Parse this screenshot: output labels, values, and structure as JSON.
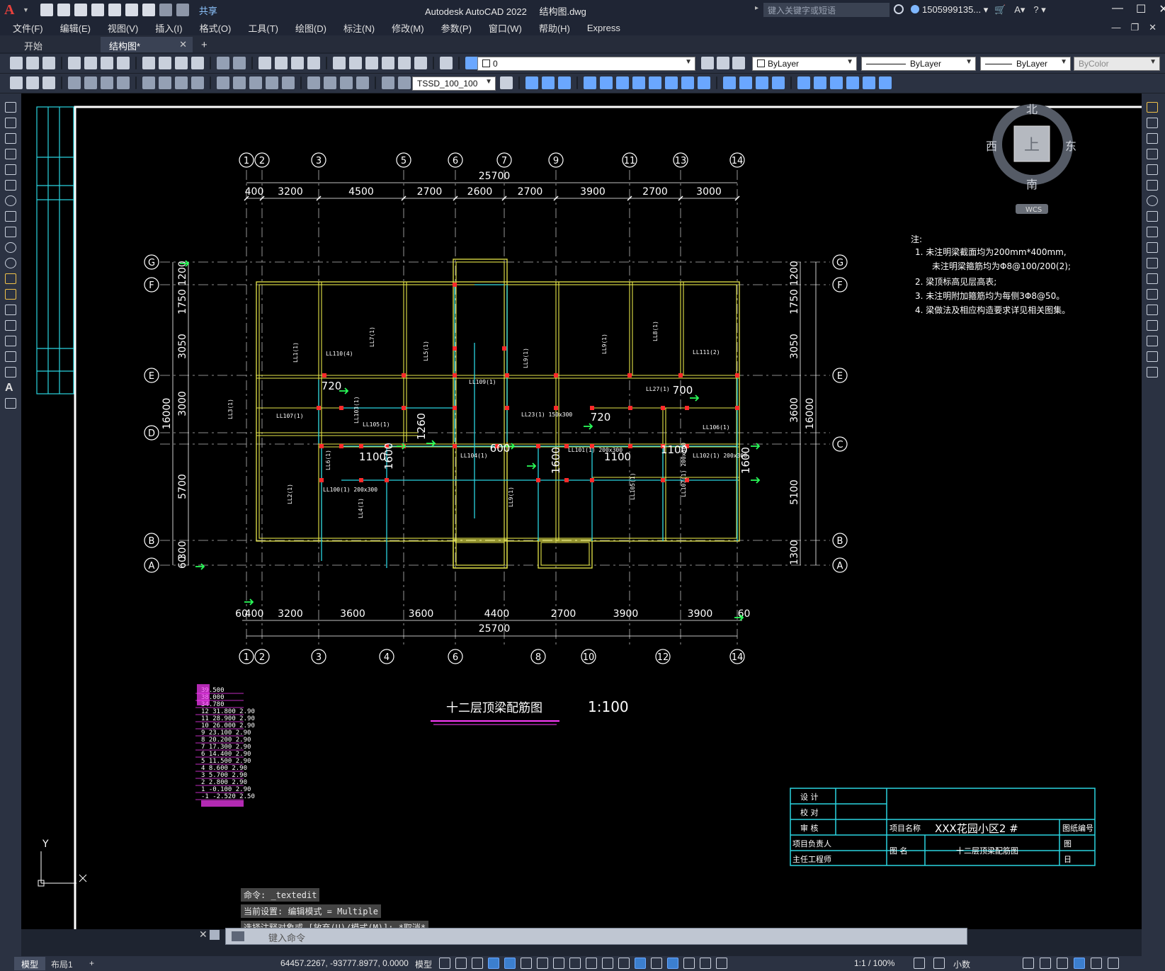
{
  "window": {
    "app_title": "Autodesk AutoCAD 2022",
    "file_title": "结构图.dwg",
    "search_placeholder": "键入关键字或短语",
    "user": "1505999135...",
    "share": "共享"
  },
  "menu": [
    "文件(F)",
    "编辑(E)",
    "视图(V)",
    "插入(I)",
    "格式(O)",
    "工具(T)",
    "绘图(D)",
    "标注(N)",
    "修改(M)",
    "参数(P)",
    "窗口(W)",
    "帮助(H)",
    "Express"
  ],
  "tabs": {
    "start": "开始",
    "active": "结构图*",
    "plus": "+"
  },
  "properties": {
    "layer": "0",
    "color": "ByLayer",
    "linetype": "ByLayer",
    "lineweight": "ByLayer",
    "plotstyle": "ByColor",
    "text_style": "TSSD_100_100"
  },
  "viewcube": {
    "top": "上",
    "north": "北",
    "south": "南",
    "east": "东",
    "west": "西",
    "wcs": "WCS"
  },
  "command": {
    "history": [
      "命令: _textedit",
      "当前设置: 编辑模式 = Multiple",
      "选择注释对象或 [放弃(U)/模式(M)]: *取消*"
    ],
    "placeholder": "键入命令"
  },
  "status": {
    "layout_tabs": [
      "模型",
      "布局1"
    ],
    "coords": "64457.2267, -93777.8977, 0.0000",
    "space": "模型",
    "scale": "1:1 / 100%",
    "units": "小数"
  },
  "drawing": {
    "title": "十二层顶梁配筋图",
    "scale": "1:100",
    "axes_top": [
      "1",
      "2",
      "3",
      "5",
      "6",
      "7",
      "9",
      "11",
      "13",
      "14"
    ],
    "axes_bottom": [
      "1",
      "2",
      "3",
      "4",
      "6",
      "8",
      "10",
      "12",
      "14"
    ],
    "axes_left": [
      "G",
      "F",
      "E",
      "D",
      "B",
      "A"
    ],
    "axes_right": [
      "G",
      "F",
      "E",
      "C",
      "B",
      "A"
    ],
    "dims_top_total": "25700",
    "dims_top": [
      "400",
      "3200",
      "4500",
      "2700",
      "2600",
      "2700",
      "3900",
      "2700",
      "3000"
    ],
    "dims_bottom_total": "25700",
    "dims_bottom": [
      "60",
      "400",
      "3200",
      "3600",
      "3600",
      "4400",
      "2700",
      "3900",
      "3900",
      "60"
    ],
    "dims_left": [
      "1200",
      "1750",
      "3050",
      "3000",
      "5700",
      "300",
      "60",
      "16000"
    ],
    "dims_right": [
      "1200",
      "1750",
      "3050",
      "3600",
      "5100",
      "1300",
      "16000"
    ],
    "notes_title": "注:",
    "notes": [
      "1. 未注明梁截面均为200mm*400mm,",
      "未注明梁箍筋均为Φ8@100/200(2);",
      "2. 梁顶标高见层高表;",
      "3. 未注明附加箍筋均为每侧3Φ8@50。",
      "4. 梁做法及相应构造要求详见相关图集。"
    ],
    "room_dims": [
      "720",
      "1260",
      "600",
      "720",
      "700",
      "1100",
      "1600",
      "1600",
      "1100",
      "1100",
      "1600"
    ],
    "beam_labels": [
      "LL1(1)",
      "LL110(4)",
      "LL7(1)",
      "LL5(1)",
      "LL9(1)",
      "LL9(1)",
      "LL8(1)",
      "LL111(2)",
      "LL109(1)",
      "LL3(1)",
      "LL107(1)",
      "LL105(1)",
      "LL103(1)",
      "LL23(1) 150x300",
      "LL27(1)",
      "LL104(1)",
      "LL101(1) 200x300",
      "LL106(1)",
      "LL102(1) 200x300",
      "LL100(1) 200x300",
      "LL105(1)",
      "LL4(1)",
      "LL2(1)",
      "LL6(1)",
      "LL9(1)",
      "LL107(1) 200x300"
    ],
    "level_table": [
      "39.500",
      "38.000",
      "34.780",
      "12 31.800 2.90",
      "11 28.900 2.90",
      "10 26.000 2.90",
      "9 23.100 2.90",
      "8 20.200 2.90",
      "7 17.300 2.90",
      "6 14.400 2.90",
      "5 11.500 2.90",
      "4 8.600 2.90",
      "3 5.700 2.90",
      "2 2.800 2.90",
      "1 -0.100 2.90",
      "-1 -2.520 2.50"
    ],
    "title_block": {
      "design": "设 计",
      "check": "校 对",
      "review": "审 核",
      "project_lead": "项目负责人",
      "chief_engineer": "主任工程师",
      "project_name_label": "项目名称",
      "project_name": "XXX花园小区2 #",
      "drawing_no_label": "图纸编号",
      "drawing_name_label": "图 名",
      "drawing_name": "十二层顶梁配筋图",
      "tu": "图",
      "ri": "日"
    },
    "ucs_y": "Y"
  },
  "colors": {
    "canvas": "#000000",
    "axis": "#ffffff",
    "beam": "#e6e64a",
    "beam_label": "#ffffff",
    "cyan": "#2ad4e0",
    "red": "#ff2a2a",
    "green": "#2aff5a",
    "magenta": "#ff3cff"
  }
}
